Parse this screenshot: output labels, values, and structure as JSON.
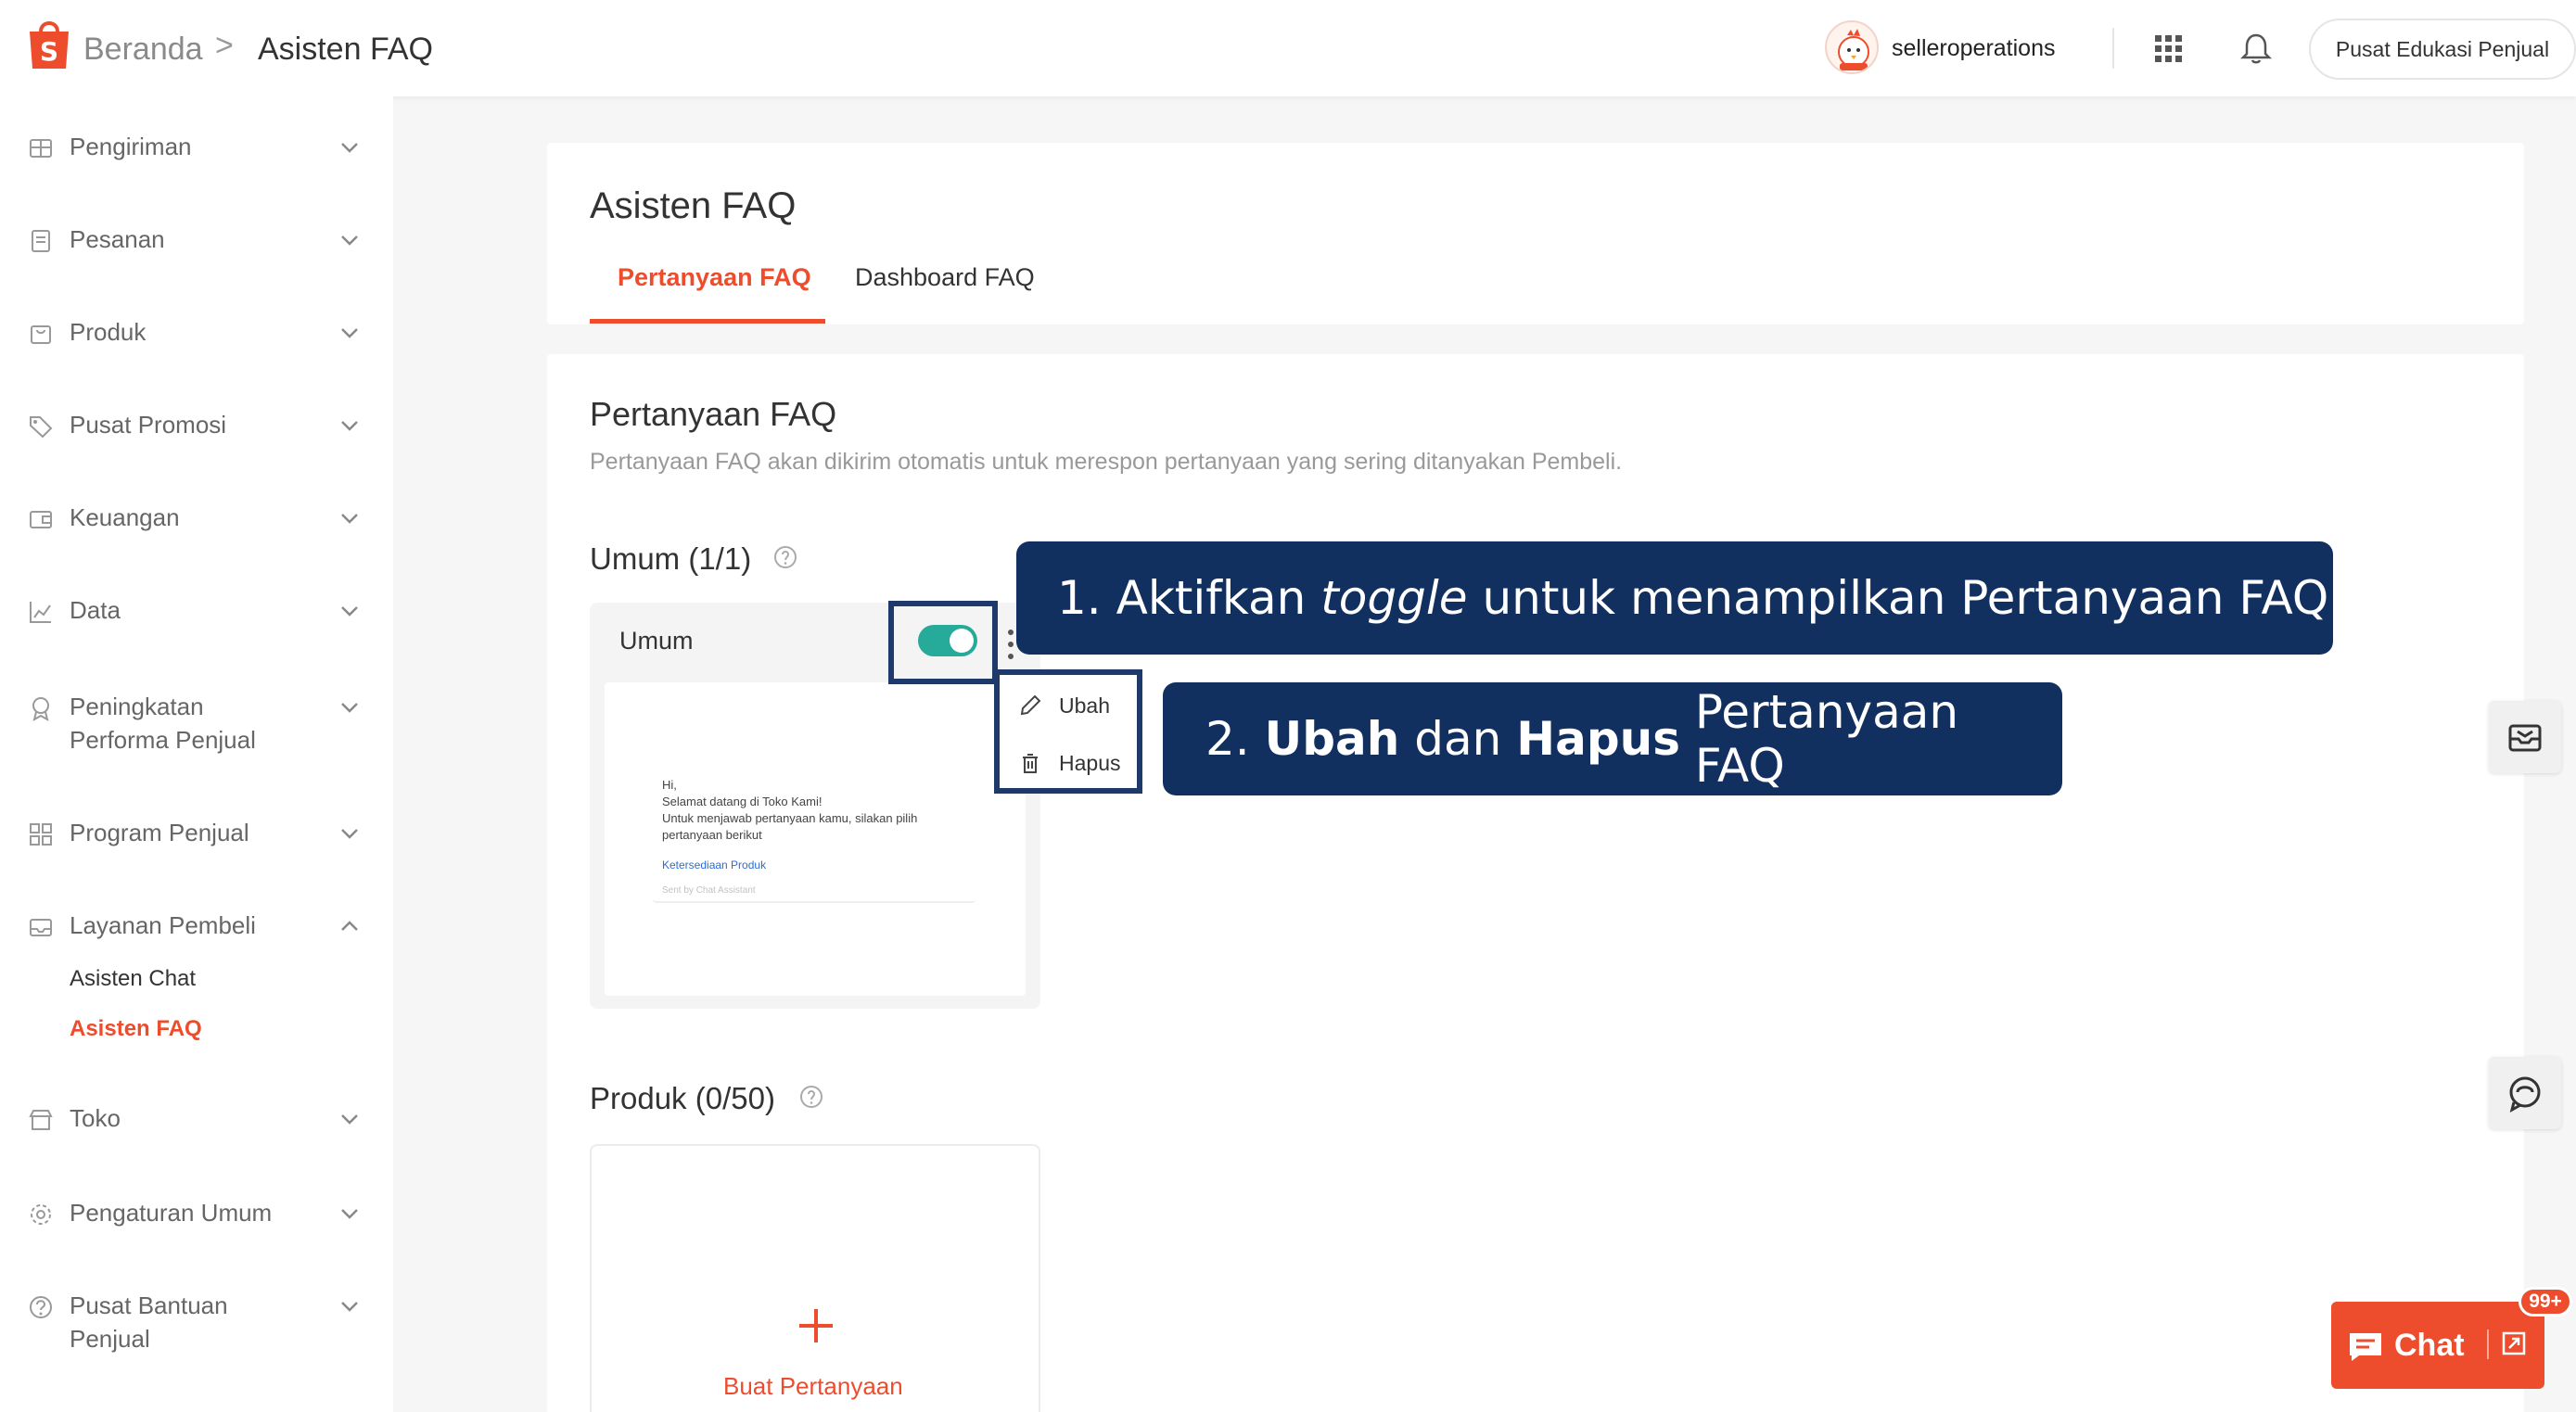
{
  "header": {
    "breadcrumb_home": "Beranda",
    "breadcrumb_separator": ">",
    "breadcrumb_current": "Asisten FAQ",
    "username": "selleroperations",
    "edu_button": "Pusat Edukasi Penjual",
    "icons": [
      "shopee-bag-icon",
      "apps-grid-icon",
      "bell-icon"
    ]
  },
  "sidebar": {
    "items": [
      {
        "label": "Pengiriman",
        "icon": "truck-icon"
      },
      {
        "label": "Pesanan",
        "icon": "clipboard-icon"
      },
      {
        "label": "Produk",
        "icon": "bag-icon"
      },
      {
        "label": "Pusat Promosi",
        "icon": "tag-icon"
      },
      {
        "label": "Keuangan",
        "icon": "wallet-icon"
      },
      {
        "label": "Data",
        "icon": "line-chart-icon"
      },
      {
        "label": "Peningkatan\nPerforma Penjual",
        "icon": "medal-icon"
      },
      {
        "label": "Program Penjual",
        "icon": "program-icon"
      },
      {
        "label": "Layanan Pembeli",
        "icon": "mail-icon"
      },
      {
        "label": "Toko",
        "icon": "store-icon"
      },
      {
        "label": "Pengaturan Umum",
        "icon": "gear-icon"
      },
      {
        "label": "Pusat Bantuan\nPenjual",
        "icon": "question-icon"
      }
    ],
    "subitems": {
      "asisten_chat": "Asisten Chat",
      "asisten_faq": "Asisten FAQ"
    }
  },
  "page": {
    "title": "Asisten FAQ",
    "tabs": [
      {
        "label": "Pertanyaan FAQ",
        "active": true
      },
      {
        "label": "Dashboard FAQ",
        "active": false
      }
    ]
  },
  "section": {
    "title": "Pertanyaan FAQ",
    "description": "Pertanyaan FAQ akan dikirim otomatis untuk merespon pertanyaan yang sering ditanyakan Pembeli.",
    "umum_heading": "Umum (1/1)",
    "faq_card_title": "Umum",
    "toggle_on": true,
    "preview": {
      "line1": "Hi,",
      "line2": "Selamat datang di Toko Kami!",
      "line3": "Untuk menjawab pertanyaan kamu, silakan pilih",
      "line4": "pertanyaan berikut",
      "link": "Ketersediaan Produk",
      "meta": "Sent by Chat Assistant"
    },
    "menu": {
      "edit": "Ubah",
      "delete": "Hapus"
    },
    "produk_heading": "Produk (0/50)",
    "add_label": "Buat Pertanyaan"
  },
  "callouts": {
    "c1_num": "1.",
    "c1_a": "Aktifkan",
    "c1_em": "toggle",
    "c1_b": "untuk menampilkan Pertanyaan FAQ",
    "c2_num": "2.",
    "c2_b1": "Ubah",
    "c2_mid": "dan",
    "c2_b2": "Hapus",
    "c2_end": "Pertanyaan FAQ"
  },
  "chat": {
    "label": "Chat",
    "badge": "99+"
  },
  "colors": {
    "accent": "#ee4d2d",
    "toggle": "#26aa99",
    "callout": "#12305f"
  }
}
